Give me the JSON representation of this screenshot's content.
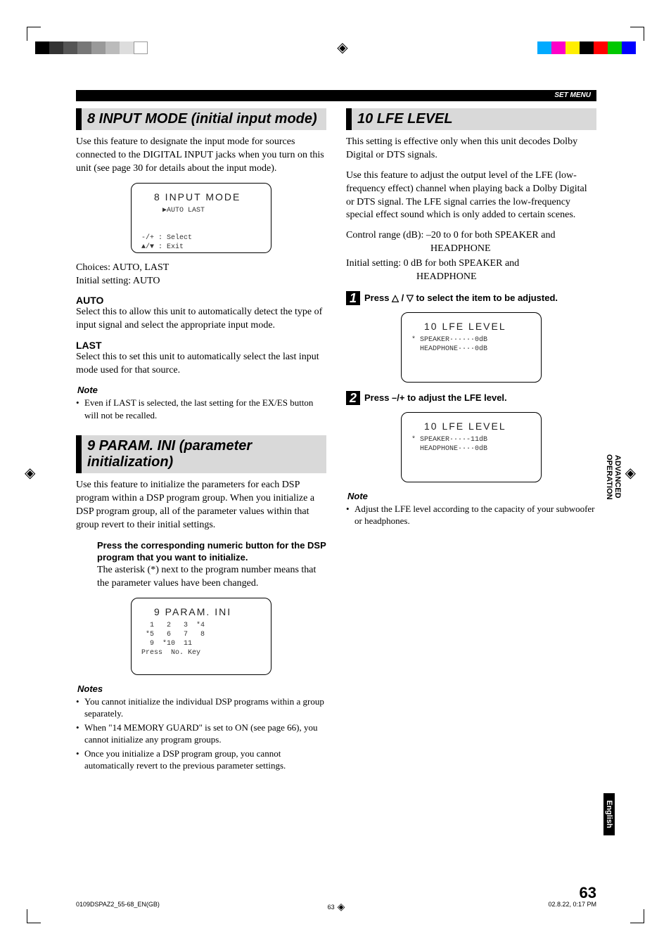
{
  "header_bar": "SET MENU",
  "left": {
    "s8": {
      "title": "8 INPUT MODE (initial input mode)",
      "intro": "Use this feature to designate the input mode for sources connected to the DIGITAL INPUT jacks when you turn on this unit (see page 30 for details about the input mode).",
      "lcd_title": "8 INPUT MODE",
      "lcd_body": "     ▶AUTO LAST\n\n\n-/+ : Select\n▲/▼ : Exit",
      "choices": "Choices: AUTO, LAST",
      "initial": "Initial setting: AUTO",
      "auto_head": "AUTO",
      "auto_body": "Select this to allow this unit to automatically detect the type of input signal and select the appropriate input mode.",
      "last_head": "LAST",
      "last_body": "Select this to set this unit to automatically select the last input mode used for that source.",
      "note_head": "Note",
      "note1": "Even if LAST is selected, the last setting for the EX/ES button will not be recalled."
    },
    "s9": {
      "title": "9 PARAM. INI (parameter initialization)",
      "intro": "Use this feature to initialize the parameters for each DSP program within a DSP program group. When you initialize a DSP program group, all of the parameter values within that group revert to their initial settings.",
      "step_bold": "Press the corresponding numeric button for the DSP program that you want to initialize.",
      "step_body": "The asterisk (*) next to the program number means that the parameter values have been changed.",
      "lcd_title": "9 PARAM. INI",
      "lcd_body": "  1   2   3  *4\n *5   6   7   8\n  9  *10  11\nPress  No. Key",
      "notes_head": "Notes",
      "note1": "You cannot initialize the individual DSP programs within a group separately.",
      "note2": "When \"14 MEMORY GUARD\" is set to ON (see page 66), you cannot initialize any program groups.",
      "note3": "Once you initialize a DSP program group, you cannot automatically revert to the previous parameter settings."
    }
  },
  "right": {
    "s10": {
      "title": "10  LFE LEVEL",
      "p1": "This setting is effective only when this unit decodes Dolby Digital or DTS signals.",
      "p2": "Use this feature to adjust the output level of the LFE (low-frequency effect) channel when playing back a Dolby Digital or DTS signal. The LFE signal carries the low-frequency special effect sound which is only added to certain scenes.",
      "range_label": "Control range (dB): –20 to 0 for both SPEAKER and",
      "range_val": "HEADPHONE",
      "init_label": "Initial setting: 0 dB for both SPEAKER and",
      "init_val": "HEADPHONE",
      "step1": "Press △ / ▽ to select the item to be adjusted.",
      "lcd1_title": "10 LFE LEVEL",
      "lcd1_body": "* SPEAKER······0dB\n  HEADPHONE····0dB",
      "step2": "Press –/+ to adjust the LFE level.",
      "lcd2_title": "10 LFE LEVEL",
      "lcd2_body": "* SPEAKER····-11dB\n  HEADPHONE····0dB",
      "note_head": "Note",
      "note1": "Adjust the LFE level according to the capacity of your subwoofer or headphones."
    }
  },
  "side_tab1": "ADVANCED OPERATION",
  "side_tab2": "English",
  "page_number": "63",
  "footer_left": "0109DSPAZ2_55-68_EN(GB)",
  "footer_mid": "63",
  "footer_right": "02.8.22, 0:17 PM",
  "colors": {
    "cyan": "#00aaff",
    "magenta": "#ff00aa",
    "yellow": "#ffee00",
    "black": "#000",
    "grays": [
      "#000",
      "#333",
      "#555",
      "#777",
      "#999",
      "#bbb",
      "#ddd",
      "#fff"
    ],
    "cmyk": [
      "#00aaff",
      "#ff00c8",
      "#ffee00",
      "#000",
      "#ff0000",
      "#00c800",
      "#0000ff"
    ]
  }
}
